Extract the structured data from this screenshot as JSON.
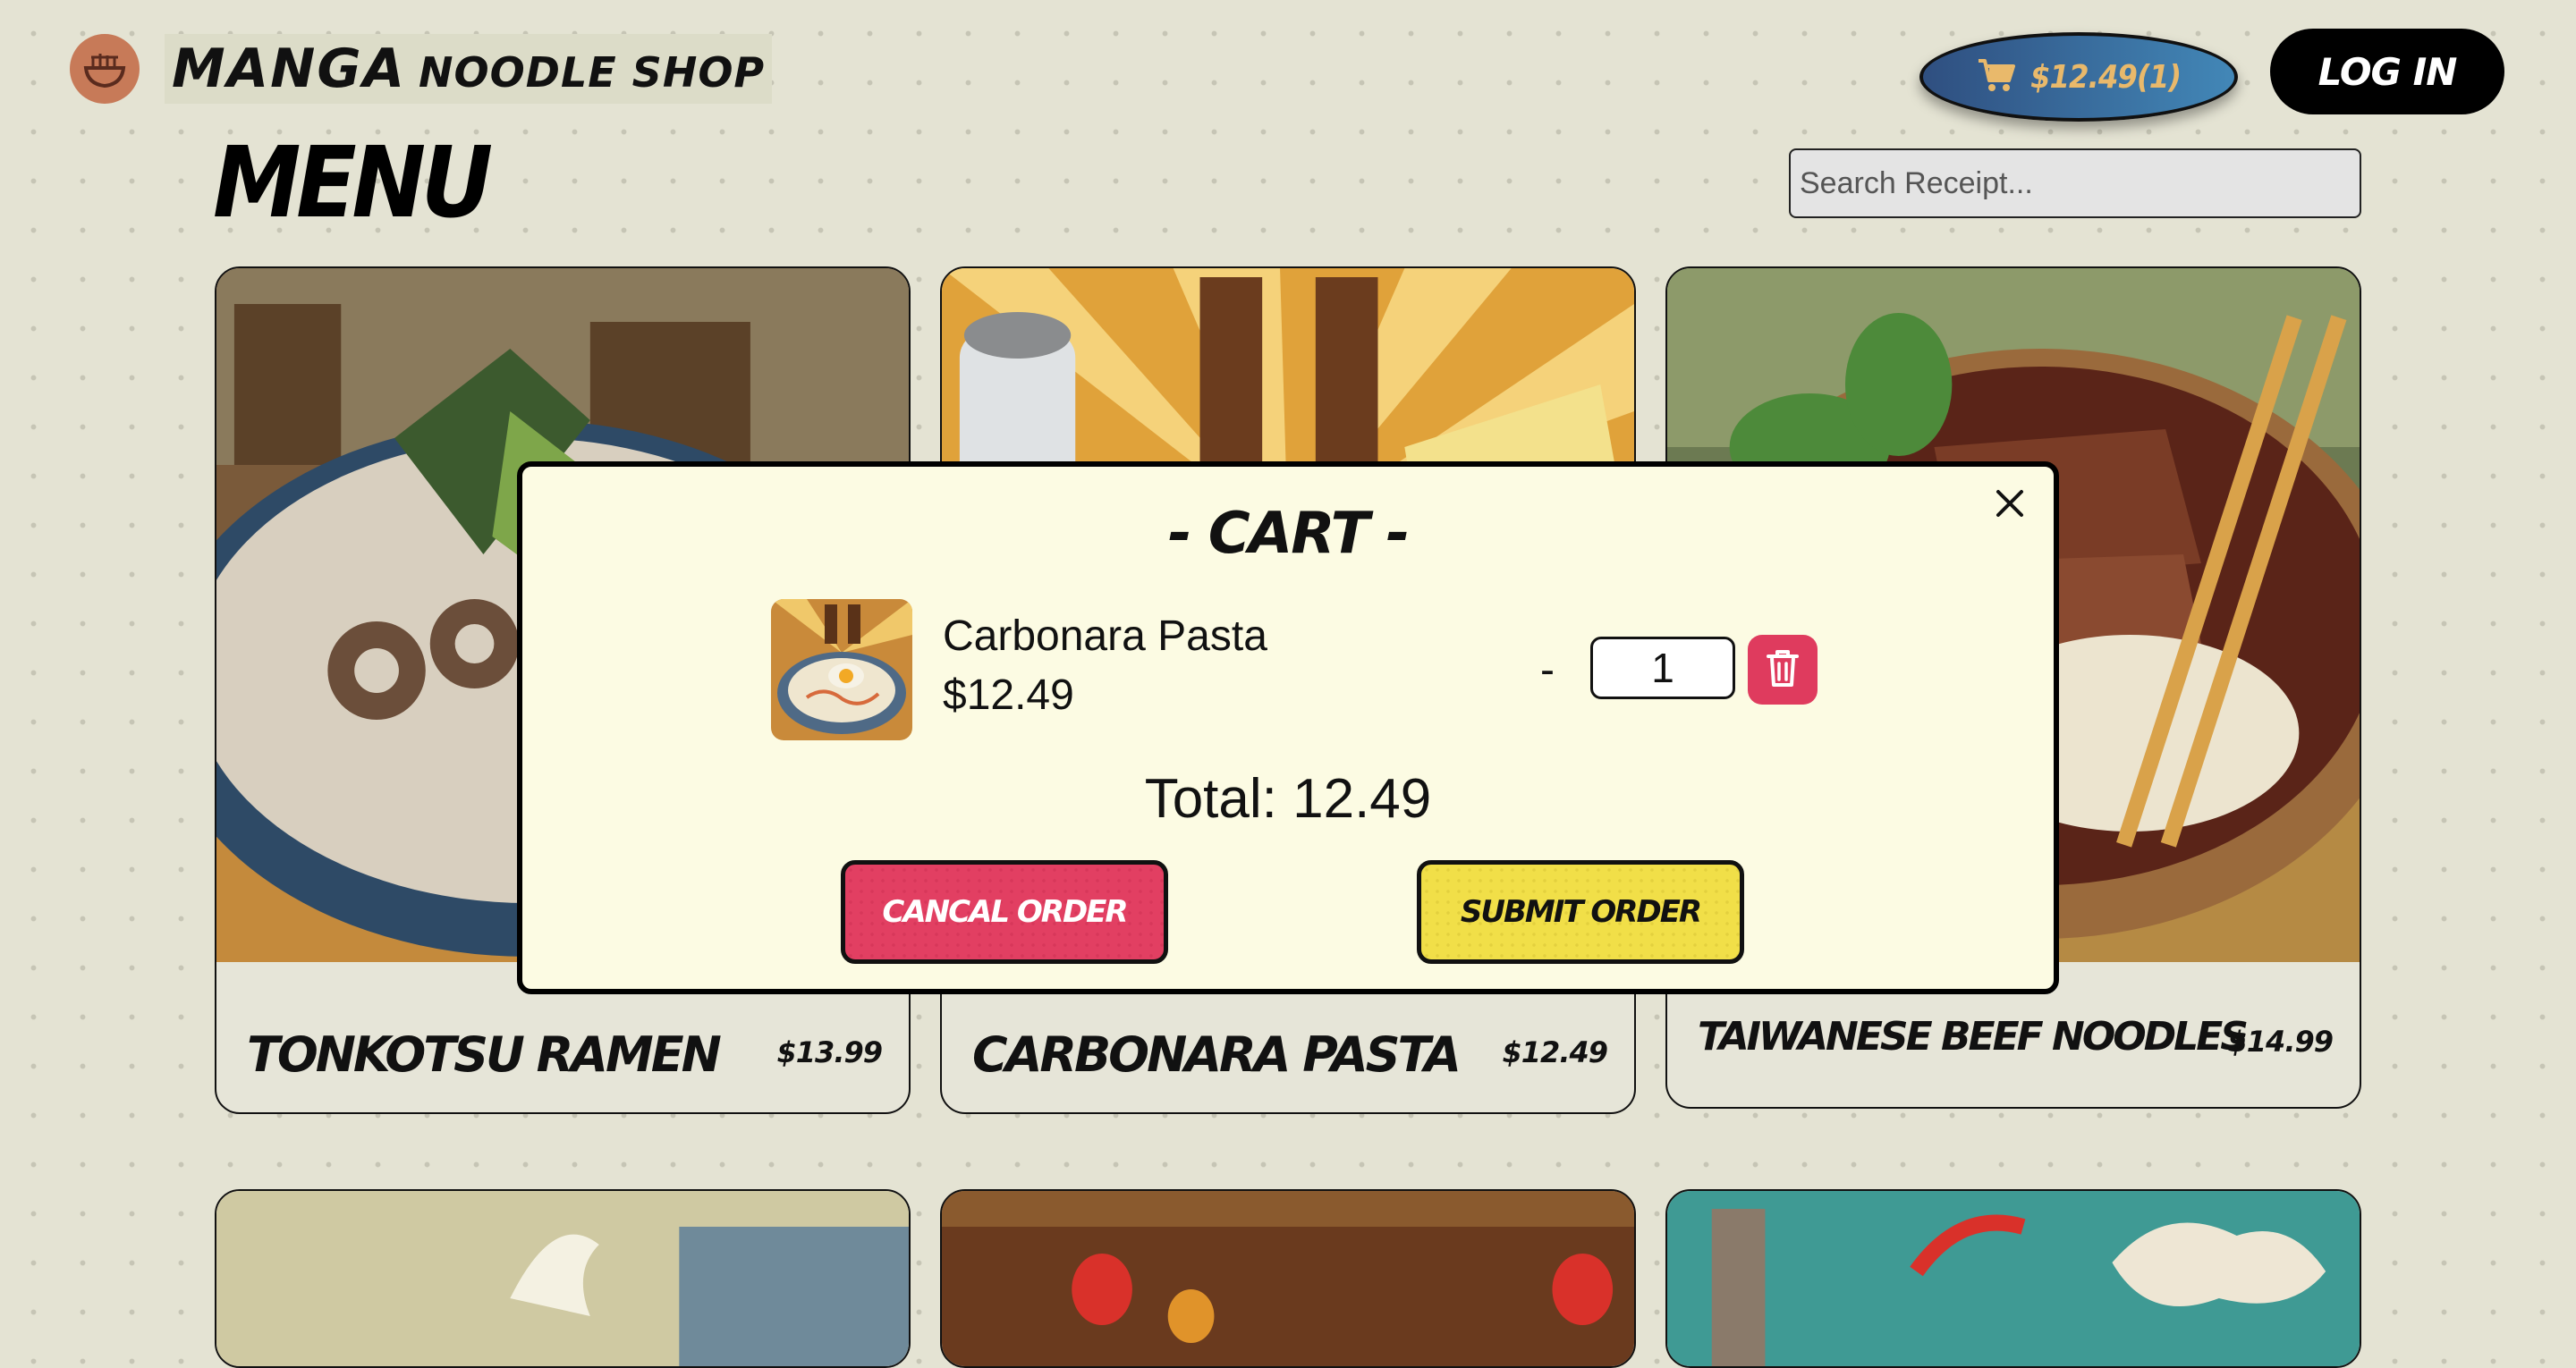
{
  "header": {
    "logo_icon": "noodle-bowl-icon",
    "brand_primary": "MANGA",
    "brand_secondary": "NOODLE SHOP",
    "cart_button": {
      "icon": "cart-icon",
      "label": "$12.49(1)"
    },
    "login_label": "LOG IN"
  },
  "page": {
    "title": "MENU",
    "search_placeholder": "Search Receipt..."
  },
  "menu_items": [
    {
      "name": "TONKOTSU RAMEN",
      "price": "$13.99"
    },
    {
      "name": "CARBONARA PASTA",
      "price": "$12.49"
    },
    {
      "name": "TAIWANESE BEEF NOODLES",
      "price": "$14.99"
    }
  ],
  "cart_modal": {
    "heading": "- CART -",
    "close_icon": "close-icon",
    "items": [
      {
        "name": "Carbonara Pasta",
        "price": "$12.49",
        "quantity": "1",
        "decrement_label": "-",
        "remove_icon": "trash-icon"
      }
    ],
    "total_text": "Total: 12.49",
    "cancel_label": "CANCAL ORDER",
    "submit_label": "SUBMIT ORDER"
  },
  "colors": {
    "background": "#e4e3d3",
    "modal_bg": "#fcfbe3",
    "danger": "#df3b5e",
    "submit": "#f1df48",
    "cart_accent": "#e9b96b"
  }
}
